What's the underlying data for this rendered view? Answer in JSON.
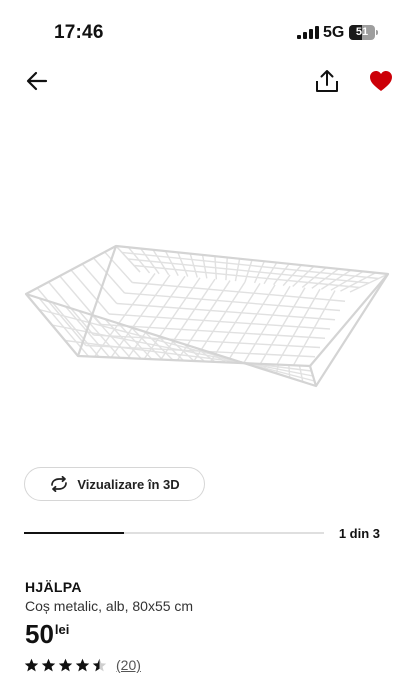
{
  "status_bar": {
    "time": "17:46",
    "network": "5G",
    "battery_percent": "51",
    "battery_level": 0.51
  },
  "nav": {
    "back_icon": "arrow-left-icon",
    "share_icon": "share-icon",
    "favorite_icon": "heart-filled-icon",
    "favorite_color": "#cc0008"
  },
  "media": {
    "image_icon": "wire-basket-image",
    "view_3d_icon": "rotate-3d-icon",
    "view_3d_label": "Vizualizare în 3D",
    "pager_label": "1 din 3",
    "progress": 0.333
  },
  "product": {
    "name": "HJÄLPA",
    "description": "Coș metalic, alb, 80x55 cm",
    "price": "50",
    "currency": "lei",
    "rating_value": 4.5,
    "rating_max": 5,
    "review_count": "(20)"
  }
}
